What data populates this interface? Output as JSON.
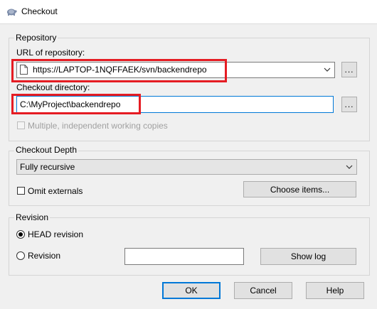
{
  "window": {
    "title": "Checkout",
    "icon": "tortoise-svn-icon"
  },
  "repository": {
    "group_title": "Repository",
    "url_label": "URL of repository:",
    "url_value": "https://LAPTOP-1NQFFAEK/svn/backendrepo",
    "browse_url_label": "...",
    "dir_label": "Checkout directory:",
    "dir_value": "C:\\MyProject\\backendrepo",
    "browse_dir_label": "...",
    "multiple_label": "Multiple, independent working copies",
    "multiple_checked": false
  },
  "depth": {
    "group_title": "Checkout Depth",
    "selected": "Fully recursive",
    "omit_externals_label": "Omit externals",
    "omit_externals_checked": false,
    "choose_items_label": "Choose items..."
  },
  "revision": {
    "group_title": "Revision",
    "head_label": "HEAD revision",
    "head_selected": true,
    "revision_label": "Revision",
    "revision_value": "",
    "show_log_label": "Show log"
  },
  "buttons": {
    "ok": "OK",
    "cancel": "Cancel",
    "help": "Help"
  },
  "colors": {
    "highlight": "#e51c23",
    "focus": "#0078d7"
  }
}
